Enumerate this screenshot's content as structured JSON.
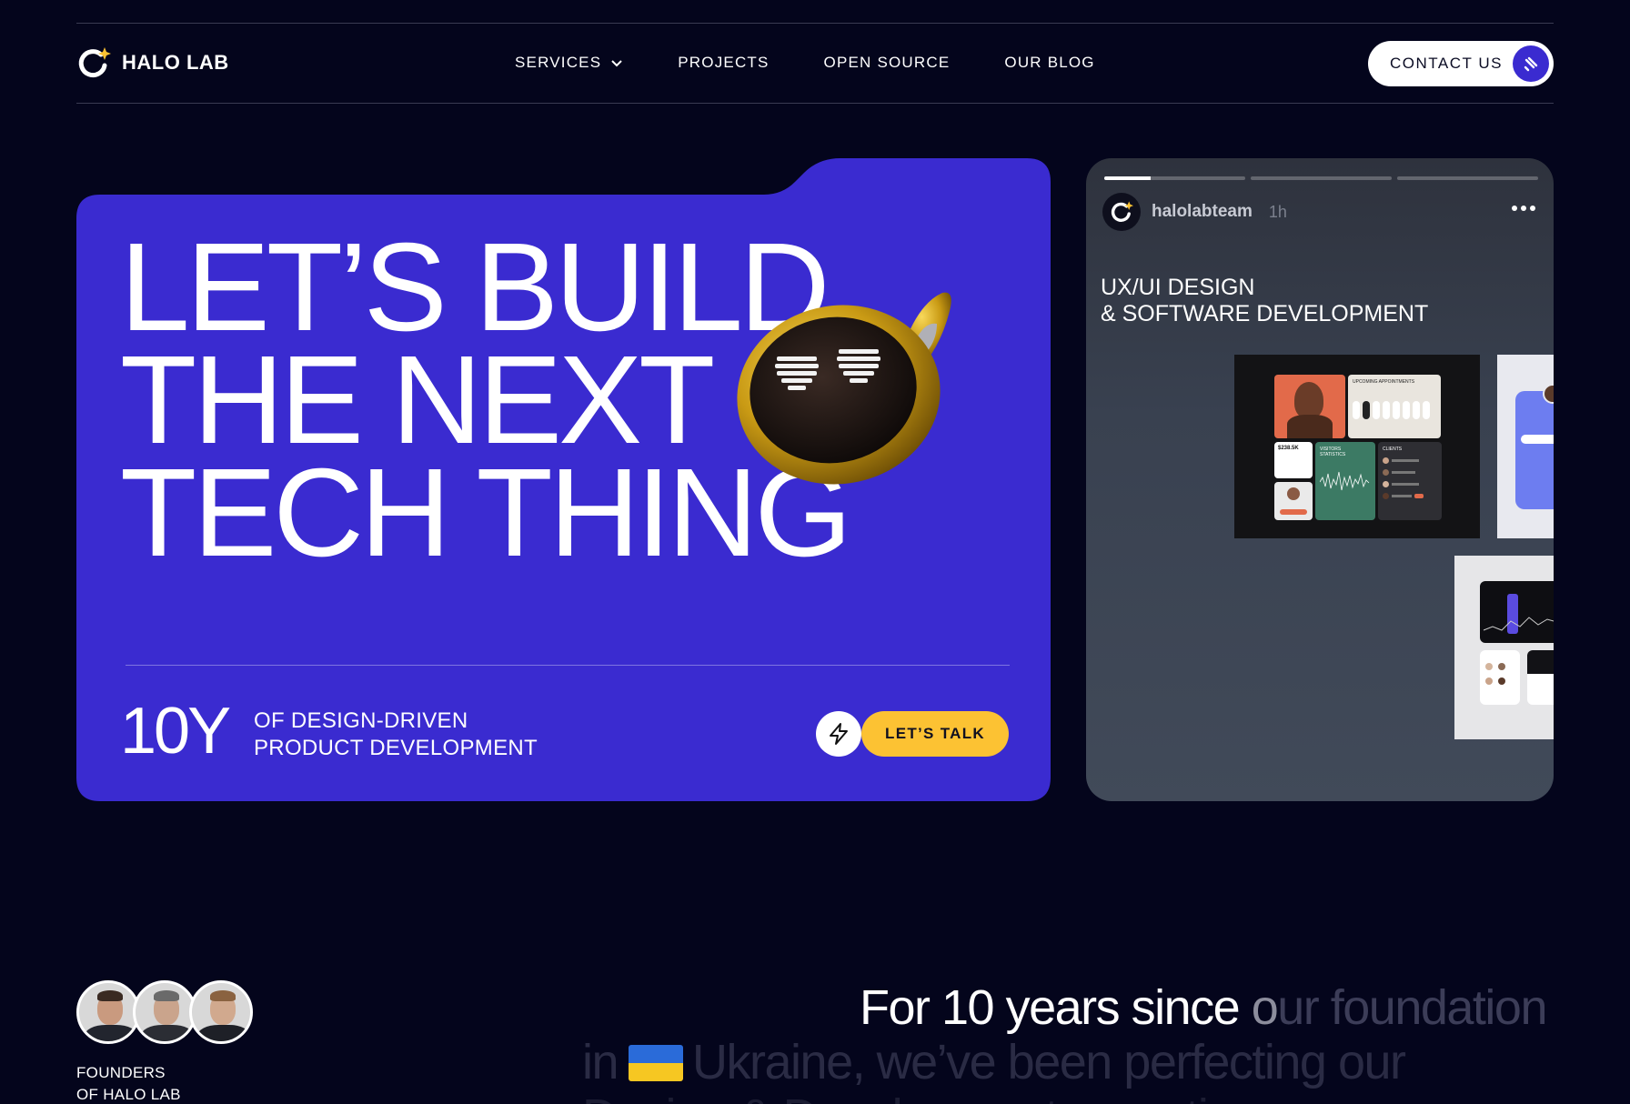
{
  "header": {
    "logo_text": "HALO LAB",
    "nav": [
      {
        "label": "SERVICES",
        "has_dropdown": true
      },
      {
        "label": "PROJECTS",
        "has_dropdown": false
      },
      {
        "label": "OPEN SOURCE",
        "has_dropdown": false
      },
      {
        "label": "OUR BLOG",
        "has_dropdown": false
      }
    ],
    "contact_label": "CONTACT US"
  },
  "hero": {
    "title": "LET’S BUILD\nTHE NEXT\nTECH THING",
    "stat": "10Y",
    "subtitle": "OF DESIGN-DRIVEN\nPRODUCT DEVELOPMENT",
    "cta_label": "LET’S TALK",
    "bg_color": "#3a2bd0",
    "cta_color": "#fcc233"
  },
  "story": {
    "username": "halolabteam",
    "time": "1h",
    "title": "UX/UI DESIGN\n& SOFTWARE DEVELOPMENT",
    "progress": [
      0.33,
      0,
      0
    ],
    "shot1_labels": {
      "appointments": "UPCOMING APPOINTMENTS",
      "visitors": "VISITORS STATISTICS",
      "clients": "CLIENTS",
      "amount": "$238.5K"
    }
  },
  "bottom": {
    "founders_label": "FOUNDERS\nOF HALO LAB",
    "intro_line1_bright": "For 10 years since ",
    "intro_line1_mid": "o",
    "intro_line1_dim": "ur foundation",
    "intro_line2_dim_a": "in",
    "intro_line2_dim_b": "Ukraine, we’ve been perfecting our",
    "intro_line3": "Design & Development expertise"
  }
}
